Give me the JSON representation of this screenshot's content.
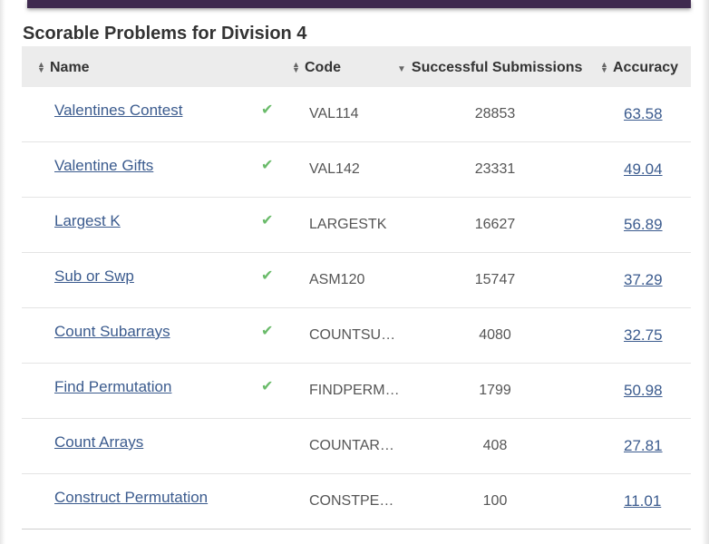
{
  "section": {
    "title": "Scorable Problems for Division 4"
  },
  "table": {
    "headers": {
      "name": "Name",
      "code": "Code",
      "submissions": "Successful Submissions",
      "accuracy": "Accuracy"
    },
    "rows": [
      {
        "name": "Valentines Contest",
        "solved": true,
        "code": "VAL114",
        "submissions": "28853",
        "accuracy": "63.58"
      },
      {
        "name": "Valentine Gifts",
        "solved": true,
        "code": "VAL142",
        "submissions": "23331",
        "accuracy": "49.04"
      },
      {
        "name": "Largest K",
        "solved": true,
        "code": "LARGESTK",
        "submissions": "16627",
        "accuracy": "56.89"
      },
      {
        "name": "Sub or Swp",
        "solved": true,
        "code": "ASM120",
        "submissions": "15747",
        "accuracy": "37.29"
      },
      {
        "name": "Count Subarrays",
        "solved": true,
        "code": "COUNTSUBARR",
        "submissions": "4080",
        "accuracy": "32.75"
      },
      {
        "name": "Find Permutation",
        "solved": true,
        "code": "FINDPERMUT",
        "submissions": "1799",
        "accuracy": "50.98"
      },
      {
        "name": "Count Arrays",
        "solved": false,
        "code": "COUNTARRAYS",
        "submissions": "408",
        "accuracy": "27.81"
      },
      {
        "name": "Construct Permutation",
        "solved": false,
        "code": "CONSTPERM",
        "submissions": "100",
        "accuracy": "11.01"
      }
    ]
  },
  "icons": {
    "check": "check-icon",
    "sort_both": "sort-icon",
    "sort_desc": "sort-desc-icon"
  },
  "colors": {
    "header_bar": "#3f2a4f",
    "link": "#3b5b8e",
    "check": "#6abb6a",
    "table_header_bg": "#ececec"
  }
}
